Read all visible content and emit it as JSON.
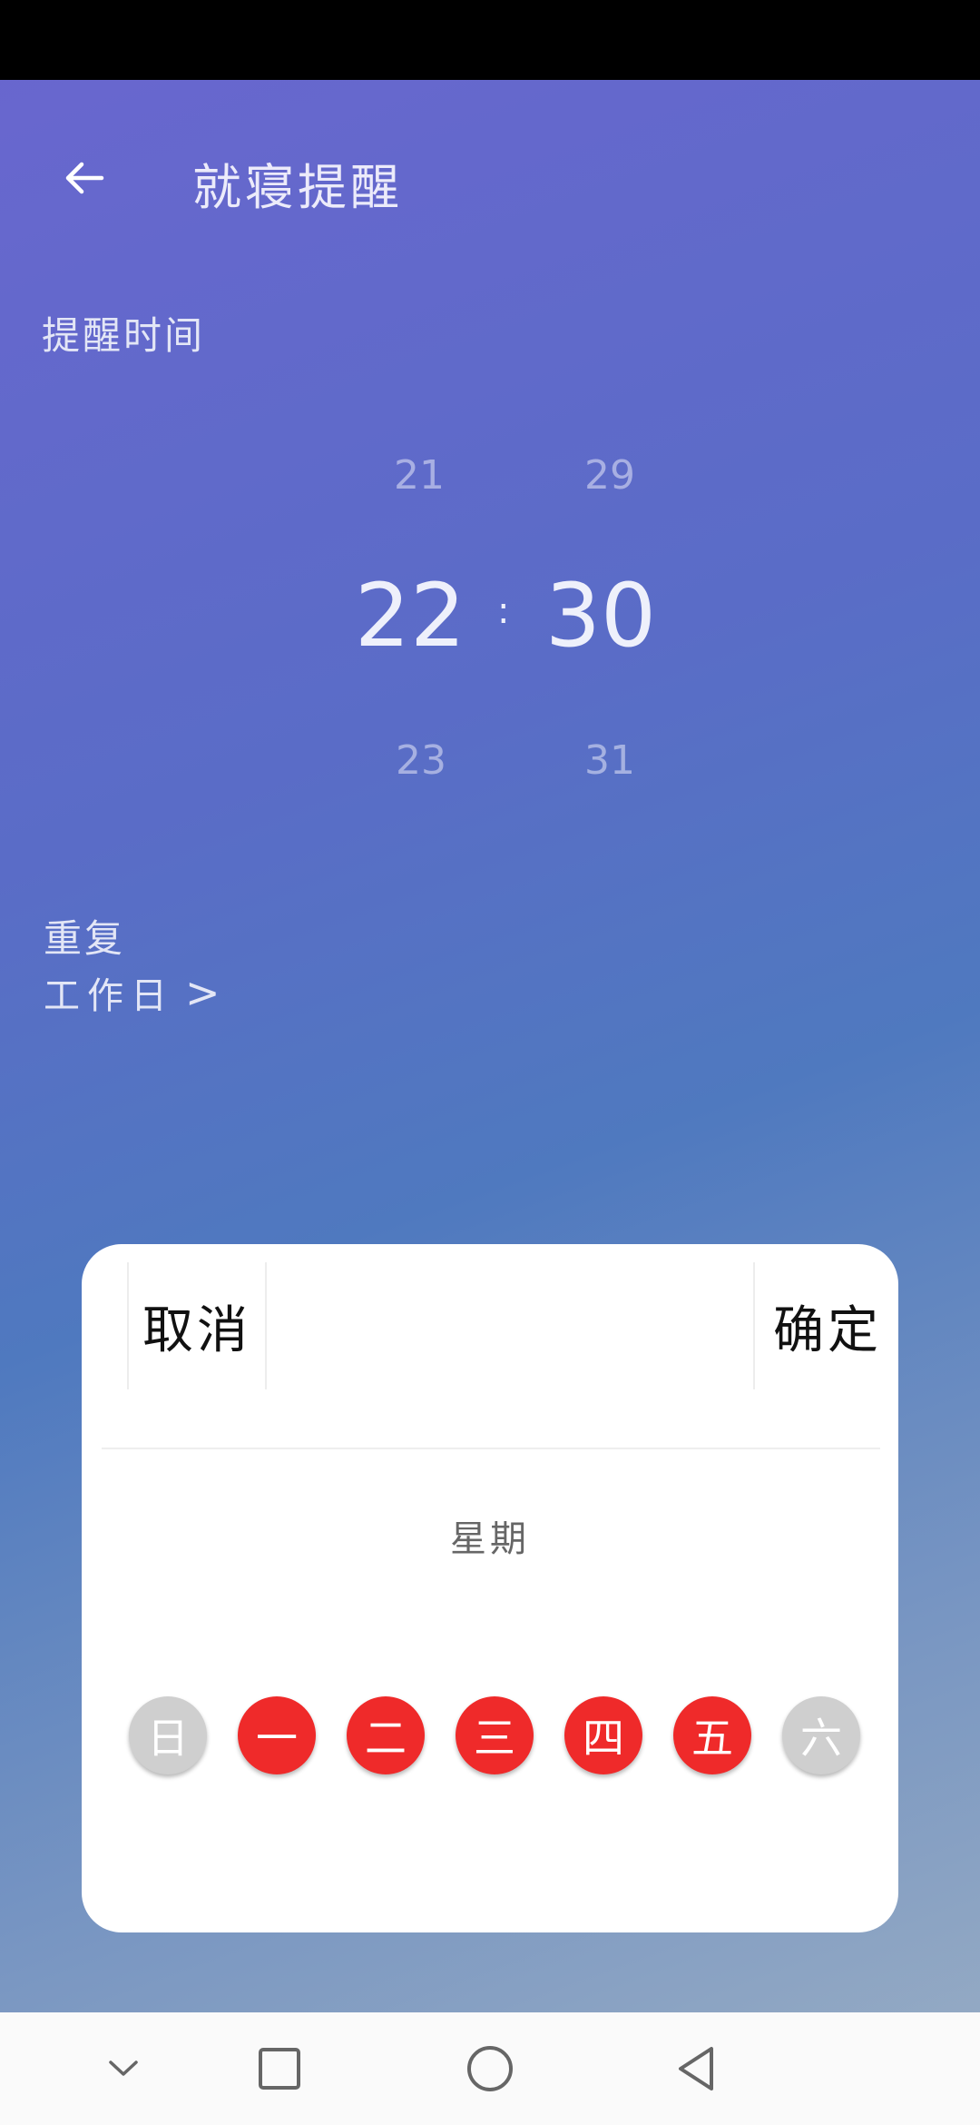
{
  "header": {
    "title": "就寝提醒",
    "back_icon": "arrow-left-icon"
  },
  "reminder_time": {
    "label": "提醒时间",
    "hour_prev": "21",
    "hour_selected": "22",
    "hour_next": "23",
    "separator": ":",
    "minute_prev": "29",
    "minute_selected": "30",
    "minute_next": "31"
  },
  "repeat": {
    "label": "重复",
    "value": "工作日",
    "chevron": ">"
  },
  "dialog": {
    "cancel_label": "取消",
    "confirm_label": "确定",
    "week_label": "星期",
    "days": [
      {
        "label": "日",
        "selected": false
      },
      {
        "label": "一",
        "selected": true
      },
      {
        "label": "二",
        "selected": true
      },
      {
        "label": "三",
        "selected": true
      },
      {
        "label": "四",
        "selected": true
      },
      {
        "label": "五",
        "selected": true
      },
      {
        "label": "六",
        "selected": false
      }
    ]
  },
  "colors": {
    "selected_day": "#ef2a2a",
    "unselected_day": "#cfcfcf",
    "gradient_top": "#6a66cf",
    "gradient_bottom": "#9aaec4"
  },
  "nav_bar": {
    "icons": [
      "chevron-down-icon",
      "square-recents-icon",
      "circle-home-icon",
      "triangle-back-icon"
    ]
  }
}
